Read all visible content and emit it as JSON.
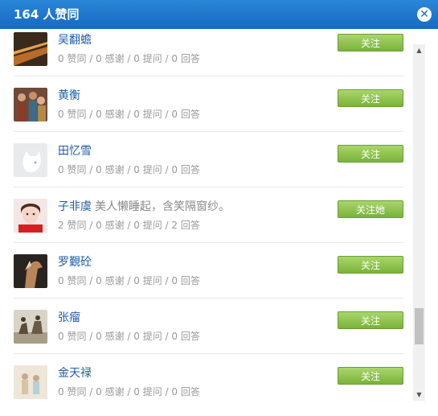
{
  "header": {
    "title": "164 人赞同"
  },
  "colors": {
    "header": "#1b6fc5",
    "follow_button": "#8cc04b",
    "name_link": "#1f5da5"
  },
  "users": [
    {
      "name": "吴翻蟾",
      "signature": "",
      "stats": "0 赞同 / 0 感谢 / 0 提问 / 0 回答",
      "button": "关注",
      "avatar": "avatar-road-icon"
    },
    {
      "name": "黄衡",
      "signature": "",
      "stats": "0 赞同 / 0 感谢 / 0 提问 / 0 回答",
      "button": "关注",
      "avatar": "avatar-crowd-icon"
    },
    {
      "name": "田忆雪",
      "signature": "",
      "stats": "0 赞同 / 0 感谢 / 0 提问 / 0 回答",
      "button": "关注",
      "avatar": "avatar-default-icon"
    },
    {
      "name": "子非虞",
      "signature": "美人懒睡起，含笑隔窗纱。",
      "stats": "2 赞同 / 0 感谢 / 0 提问 / 2 回答",
      "button": "关注她",
      "avatar": "avatar-girl-icon"
    },
    {
      "name": "罗覲砼",
      "signature": "",
      "stats": "0 赞同 / 0 感谢 / 0 提问 / 0 回答",
      "button": "关注",
      "avatar": "avatar-horse-icon"
    },
    {
      "name": "张瘤",
      "signature": "",
      "stats": "0 赞同 / 0 感谢 / 0 提问 / 0 回答",
      "button": "关注",
      "avatar": "avatar-riders-icon"
    },
    {
      "name": "金天禄",
      "signature": "",
      "stats": "0 赞同 / 0 感谢 / 0 提问 / 0 回答",
      "button": "关注",
      "avatar": "avatar-figures-icon"
    }
  ]
}
